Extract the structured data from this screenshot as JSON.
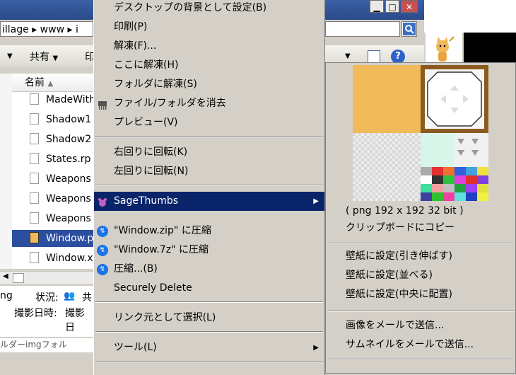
{
  "window": {
    "address_path": "illage ▸ www ▸ i",
    "toolbar_share": "共有",
    "toolbar_print_partial": "印",
    "column_name": "名前",
    "status_label": "状況:",
    "status_value": "共",
    "date_label": "撮影日時:",
    "date_value": "撮影日",
    "left_partial": "ng",
    "bottom_partial": "ルダーimgフォル",
    "files": [
      {
        "name": "MadeWith"
      },
      {
        "name": "Shadow1"
      },
      {
        "name": "Shadow2"
      },
      {
        "name": "States.rp"
      },
      {
        "name": "Weapons"
      },
      {
        "name": "Weapons"
      },
      {
        "name": "Weapons"
      },
      {
        "name": "Window.p"
      },
      {
        "name": "Window.x"
      }
    ]
  },
  "context_menu": {
    "items": [
      {
        "label": "デスクトップの背景として設定(B)"
      },
      {
        "label": "印刷(P)"
      },
      {
        "label": "解凍(F)..."
      },
      {
        "label": "ここに解凍(H)"
      },
      {
        "label": "フォルダに解凍(S)"
      },
      {
        "label": "ファイル/フォルダを消去"
      },
      {
        "label": "プレビュー(V)"
      },
      {
        "label": "右回りに回転(K)"
      },
      {
        "label": "左回りに回転(N)"
      },
      {
        "label": "SageThumbs"
      },
      {
        "label": "\"Window.zip\" に圧縮"
      },
      {
        "label": "\"Window.7z\" に圧縮"
      },
      {
        "label": "圧縮...(B)"
      },
      {
        "label": "Securely Delete"
      },
      {
        "label": "リンク元として選択(L)"
      },
      {
        "label": "ツール(L)"
      }
    ]
  },
  "submenu": {
    "image_info": "( png 192 x 192 32 bit )",
    "copy_clipboard": "クリップボードにコピー",
    "wallpaper_stretch": "壁紙に設定(引き伸ばす)",
    "wallpaper_tile": "壁紙に設定(並べる)",
    "wallpaper_center": "壁紙に設定(中央に配置)",
    "mail_image": "画像をメールで送信...",
    "mail_thumbnail": "サムネイルをメールで送信..."
  },
  "colors": {
    "highlight": "#0a246a",
    "menu_bg": "#d4d0c8",
    "thumb_orange": "#f0b95a",
    "thumb_frame": "#8b5a1e"
  }
}
